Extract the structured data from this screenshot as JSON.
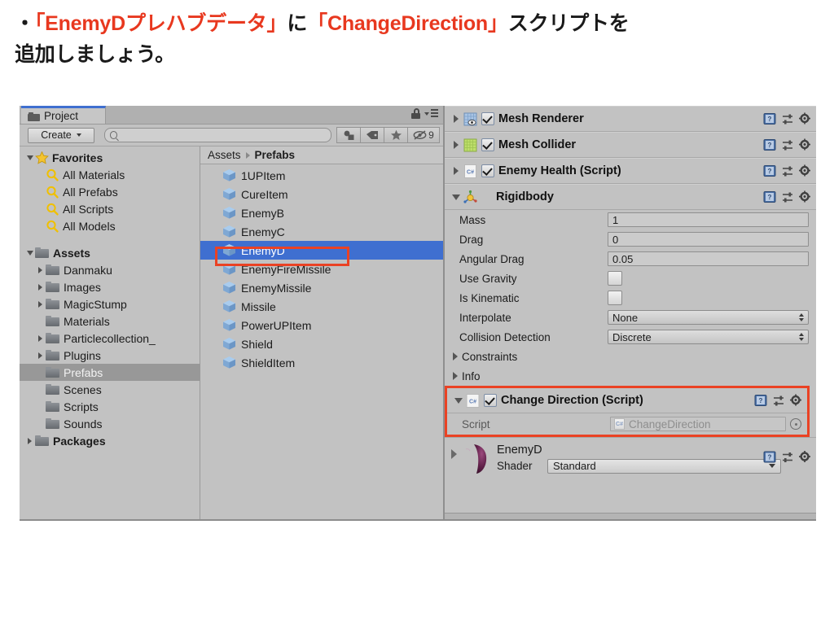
{
  "caption": {
    "bullet": "・",
    "part1_quote": "「EnemyDプレハブデータ」",
    "part2": "に",
    "part3_quote": "「ChangeDirection」",
    "part4": "スクリプトを",
    "line2": "追加しましょう。",
    "accent_color": "#e8381f"
  },
  "project": {
    "tab_label": "Project",
    "tab_icon": "folder-icon",
    "lock_icon": "lock-icon",
    "menu_icon": "panel-menu-icon",
    "create_label": "Create",
    "search_value": "",
    "search_placeholder": "",
    "filter_buttons": [
      {
        "name": "filter-by-type-icon"
      },
      {
        "name": "filter-by-label-icon"
      },
      {
        "name": "favorite-star-icon"
      }
    ],
    "visibility_icon": "eye-slash-icon",
    "visibility_count": "9",
    "tree": [
      {
        "label": "Favorites",
        "icon": "star-icon",
        "indent": 0,
        "arrow": "down",
        "bold": true,
        "selected": false
      },
      {
        "label": "All Materials",
        "icon": "search-icon",
        "indent": 1,
        "arrow": "none",
        "bold": false,
        "selected": false
      },
      {
        "label": "All Prefabs",
        "icon": "search-icon",
        "indent": 1,
        "arrow": "none",
        "bold": false,
        "selected": false
      },
      {
        "label": "All Scripts",
        "icon": "search-icon",
        "indent": 1,
        "arrow": "none",
        "bold": false,
        "selected": false
      },
      {
        "label": "All Models",
        "icon": "search-icon",
        "indent": 1,
        "arrow": "none",
        "bold": false,
        "selected": false
      },
      {
        "label": "",
        "icon": "none",
        "indent": 0,
        "arrow": "none",
        "bold": false,
        "selected": false
      },
      {
        "label": "Assets",
        "icon": "folder-icon",
        "indent": 0,
        "arrow": "down",
        "bold": true,
        "selected": false
      },
      {
        "label": "Danmaku",
        "icon": "folder-icon",
        "indent": 1,
        "arrow": "right",
        "bold": false,
        "selected": false
      },
      {
        "label": "Images",
        "icon": "folder-icon",
        "indent": 1,
        "arrow": "right",
        "bold": false,
        "selected": false
      },
      {
        "label": "MagicStump",
        "icon": "folder-icon",
        "indent": 1,
        "arrow": "right",
        "bold": false,
        "selected": false
      },
      {
        "label": "Materials",
        "icon": "folder-icon",
        "indent": 1,
        "arrow": "none",
        "bold": false,
        "selected": false
      },
      {
        "label": "Particlecollection_",
        "icon": "folder-icon",
        "indent": 1,
        "arrow": "right",
        "bold": false,
        "selected": false
      },
      {
        "label": "Plugins",
        "icon": "folder-icon",
        "indent": 1,
        "arrow": "right",
        "bold": false,
        "selected": false
      },
      {
        "label": "Prefabs",
        "icon": "folder-icon",
        "indent": 1,
        "arrow": "none",
        "bold": false,
        "selected": true
      },
      {
        "label": "Scenes",
        "icon": "folder-icon",
        "indent": 1,
        "arrow": "none",
        "bold": false,
        "selected": false
      },
      {
        "label": "Scripts",
        "icon": "folder-icon",
        "indent": 1,
        "arrow": "none",
        "bold": false,
        "selected": false
      },
      {
        "label": "Sounds",
        "icon": "folder-icon",
        "indent": 1,
        "arrow": "none",
        "bold": false,
        "selected": false
      },
      {
        "label": "Packages",
        "icon": "folder-icon",
        "indent": 0,
        "arrow": "right",
        "bold": true,
        "selected": false
      }
    ],
    "breadcrumb": {
      "root": "Assets",
      "current": "Prefabs"
    },
    "assets": [
      {
        "label": "1UPItem",
        "selected": false
      },
      {
        "label": "CureItem",
        "selected": false
      },
      {
        "label": "EnemyB",
        "selected": false
      },
      {
        "label": "EnemyC",
        "selected": false
      },
      {
        "label": "EnemyD",
        "selected": true
      },
      {
        "label": "EnemyFireMissile",
        "selected": false
      },
      {
        "label": "EnemyMissile",
        "selected": false
      },
      {
        "label": "Missile",
        "selected": false
      },
      {
        "label": "PowerUPItem",
        "selected": false
      },
      {
        "label": "Shield",
        "selected": false
      },
      {
        "label": "ShieldItem",
        "selected": false
      }
    ],
    "selection_color": "#3f6fd0",
    "highlight_color": "#ea4224"
  },
  "inspector": {
    "components": [
      {
        "title": "Mesh Renderer",
        "icon": "mesh-renderer-icon",
        "enabled": true,
        "expanded": false,
        "has_checkbox": true
      },
      {
        "title": "Mesh Collider",
        "icon": "mesh-collider-icon",
        "enabled": true,
        "expanded": false,
        "has_checkbox": true
      },
      {
        "title": "Enemy Health (Script)",
        "icon": "csharp-script-icon",
        "enabled": true,
        "expanded": false,
        "has_checkbox": true
      },
      {
        "title": "Rigidbody",
        "icon": "rigidbody-icon",
        "enabled": true,
        "expanded": true,
        "has_checkbox": false
      }
    ],
    "rigidbody": {
      "properties": [
        {
          "label": "Mass",
          "type": "text",
          "value": "1"
        },
        {
          "label": "Drag",
          "type": "text",
          "value": "0"
        },
        {
          "label": "Angular Drag",
          "type": "text",
          "value": "0.05"
        },
        {
          "label": "Use Gravity",
          "type": "checkbox",
          "value": ""
        },
        {
          "label": "Is Kinematic",
          "type": "checkbox",
          "value": ""
        },
        {
          "label": "Interpolate",
          "type": "dropdown",
          "value": "None"
        },
        {
          "label": "Collision Detection",
          "type": "dropdown",
          "value": "Discrete"
        }
      ],
      "foldouts": [
        {
          "label": "Constraints"
        },
        {
          "label": "Info"
        }
      ]
    },
    "change_direction": {
      "title": "Change Direction (Script)",
      "icon": "csharp-script-icon",
      "enabled": true,
      "expanded": true,
      "script_label": "Script",
      "script_value": "ChangeDirection",
      "object_picker_icon": "object-picker-icon",
      "highlighted": true
    },
    "material": {
      "name": "EnemyD",
      "shader_label": "Shader",
      "shader_value": "Standard",
      "preview_icon": "material-sphere-preview"
    },
    "header_icons": {
      "help": "help-book-icon",
      "preset": "preset-sliders-icon",
      "settings": "gear-icon"
    }
  }
}
